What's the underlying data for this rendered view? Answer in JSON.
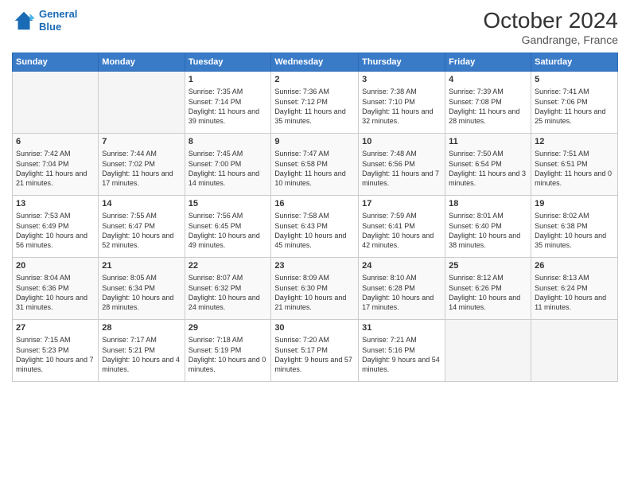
{
  "header": {
    "logo_line1": "General",
    "logo_line2": "Blue",
    "month_title": "October 2024",
    "subtitle": "Gandrange, France"
  },
  "weekdays": [
    "Sunday",
    "Monday",
    "Tuesday",
    "Wednesday",
    "Thursday",
    "Friday",
    "Saturday"
  ],
  "weeks": [
    [
      {
        "day": "",
        "sunrise": "",
        "sunset": "",
        "daylight": "",
        "empty": true
      },
      {
        "day": "",
        "sunrise": "",
        "sunset": "",
        "daylight": "",
        "empty": true
      },
      {
        "day": "1",
        "sunrise": "Sunrise: 7:35 AM",
        "sunset": "Sunset: 7:14 PM",
        "daylight": "Daylight: 11 hours and 39 minutes."
      },
      {
        "day": "2",
        "sunrise": "Sunrise: 7:36 AM",
        "sunset": "Sunset: 7:12 PM",
        "daylight": "Daylight: 11 hours and 35 minutes."
      },
      {
        "day": "3",
        "sunrise": "Sunrise: 7:38 AM",
        "sunset": "Sunset: 7:10 PM",
        "daylight": "Daylight: 11 hours and 32 minutes."
      },
      {
        "day": "4",
        "sunrise": "Sunrise: 7:39 AM",
        "sunset": "Sunset: 7:08 PM",
        "daylight": "Daylight: 11 hours and 28 minutes."
      },
      {
        "day": "5",
        "sunrise": "Sunrise: 7:41 AM",
        "sunset": "Sunset: 7:06 PM",
        "daylight": "Daylight: 11 hours and 25 minutes."
      }
    ],
    [
      {
        "day": "6",
        "sunrise": "Sunrise: 7:42 AM",
        "sunset": "Sunset: 7:04 PM",
        "daylight": "Daylight: 11 hours and 21 minutes."
      },
      {
        "day": "7",
        "sunrise": "Sunrise: 7:44 AM",
        "sunset": "Sunset: 7:02 PM",
        "daylight": "Daylight: 11 hours and 17 minutes."
      },
      {
        "day": "8",
        "sunrise": "Sunrise: 7:45 AM",
        "sunset": "Sunset: 7:00 PM",
        "daylight": "Daylight: 11 hours and 14 minutes."
      },
      {
        "day": "9",
        "sunrise": "Sunrise: 7:47 AM",
        "sunset": "Sunset: 6:58 PM",
        "daylight": "Daylight: 11 hours and 10 minutes."
      },
      {
        "day": "10",
        "sunrise": "Sunrise: 7:48 AM",
        "sunset": "Sunset: 6:56 PM",
        "daylight": "Daylight: 11 hours and 7 minutes."
      },
      {
        "day": "11",
        "sunrise": "Sunrise: 7:50 AM",
        "sunset": "Sunset: 6:54 PM",
        "daylight": "Daylight: 11 hours and 3 minutes."
      },
      {
        "day": "12",
        "sunrise": "Sunrise: 7:51 AM",
        "sunset": "Sunset: 6:51 PM",
        "daylight": "Daylight: 11 hours and 0 minutes."
      }
    ],
    [
      {
        "day": "13",
        "sunrise": "Sunrise: 7:53 AM",
        "sunset": "Sunset: 6:49 PM",
        "daylight": "Daylight: 10 hours and 56 minutes."
      },
      {
        "day": "14",
        "sunrise": "Sunrise: 7:55 AM",
        "sunset": "Sunset: 6:47 PM",
        "daylight": "Daylight: 10 hours and 52 minutes."
      },
      {
        "day": "15",
        "sunrise": "Sunrise: 7:56 AM",
        "sunset": "Sunset: 6:45 PM",
        "daylight": "Daylight: 10 hours and 49 minutes."
      },
      {
        "day": "16",
        "sunrise": "Sunrise: 7:58 AM",
        "sunset": "Sunset: 6:43 PM",
        "daylight": "Daylight: 10 hours and 45 minutes."
      },
      {
        "day": "17",
        "sunrise": "Sunrise: 7:59 AM",
        "sunset": "Sunset: 6:41 PM",
        "daylight": "Daylight: 10 hours and 42 minutes."
      },
      {
        "day": "18",
        "sunrise": "Sunrise: 8:01 AM",
        "sunset": "Sunset: 6:40 PM",
        "daylight": "Daylight: 10 hours and 38 minutes."
      },
      {
        "day": "19",
        "sunrise": "Sunrise: 8:02 AM",
        "sunset": "Sunset: 6:38 PM",
        "daylight": "Daylight: 10 hours and 35 minutes."
      }
    ],
    [
      {
        "day": "20",
        "sunrise": "Sunrise: 8:04 AM",
        "sunset": "Sunset: 6:36 PM",
        "daylight": "Daylight: 10 hours and 31 minutes."
      },
      {
        "day": "21",
        "sunrise": "Sunrise: 8:05 AM",
        "sunset": "Sunset: 6:34 PM",
        "daylight": "Daylight: 10 hours and 28 minutes."
      },
      {
        "day": "22",
        "sunrise": "Sunrise: 8:07 AM",
        "sunset": "Sunset: 6:32 PM",
        "daylight": "Daylight: 10 hours and 24 minutes."
      },
      {
        "day": "23",
        "sunrise": "Sunrise: 8:09 AM",
        "sunset": "Sunset: 6:30 PM",
        "daylight": "Daylight: 10 hours and 21 minutes."
      },
      {
        "day": "24",
        "sunrise": "Sunrise: 8:10 AM",
        "sunset": "Sunset: 6:28 PM",
        "daylight": "Daylight: 10 hours and 17 minutes."
      },
      {
        "day": "25",
        "sunrise": "Sunrise: 8:12 AM",
        "sunset": "Sunset: 6:26 PM",
        "daylight": "Daylight: 10 hours and 14 minutes."
      },
      {
        "day": "26",
        "sunrise": "Sunrise: 8:13 AM",
        "sunset": "Sunset: 6:24 PM",
        "daylight": "Daylight: 10 hours and 11 minutes."
      }
    ],
    [
      {
        "day": "27",
        "sunrise": "Sunrise: 7:15 AM",
        "sunset": "Sunset: 5:23 PM",
        "daylight": "Daylight: 10 hours and 7 minutes."
      },
      {
        "day": "28",
        "sunrise": "Sunrise: 7:17 AM",
        "sunset": "Sunset: 5:21 PM",
        "daylight": "Daylight: 10 hours and 4 minutes."
      },
      {
        "day": "29",
        "sunrise": "Sunrise: 7:18 AM",
        "sunset": "Sunset: 5:19 PM",
        "daylight": "Daylight: 10 hours and 0 minutes."
      },
      {
        "day": "30",
        "sunrise": "Sunrise: 7:20 AM",
        "sunset": "Sunset: 5:17 PM",
        "daylight": "Daylight: 9 hours and 57 minutes."
      },
      {
        "day": "31",
        "sunrise": "Sunrise: 7:21 AM",
        "sunset": "Sunset: 5:16 PM",
        "daylight": "Daylight: 9 hours and 54 minutes."
      },
      {
        "day": "",
        "sunrise": "",
        "sunset": "",
        "daylight": "",
        "empty": true
      },
      {
        "day": "",
        "sunrise": "",
        "sunset": "",
        "daylight": "",
        "empty": true
      }
    ]
  ]
}
